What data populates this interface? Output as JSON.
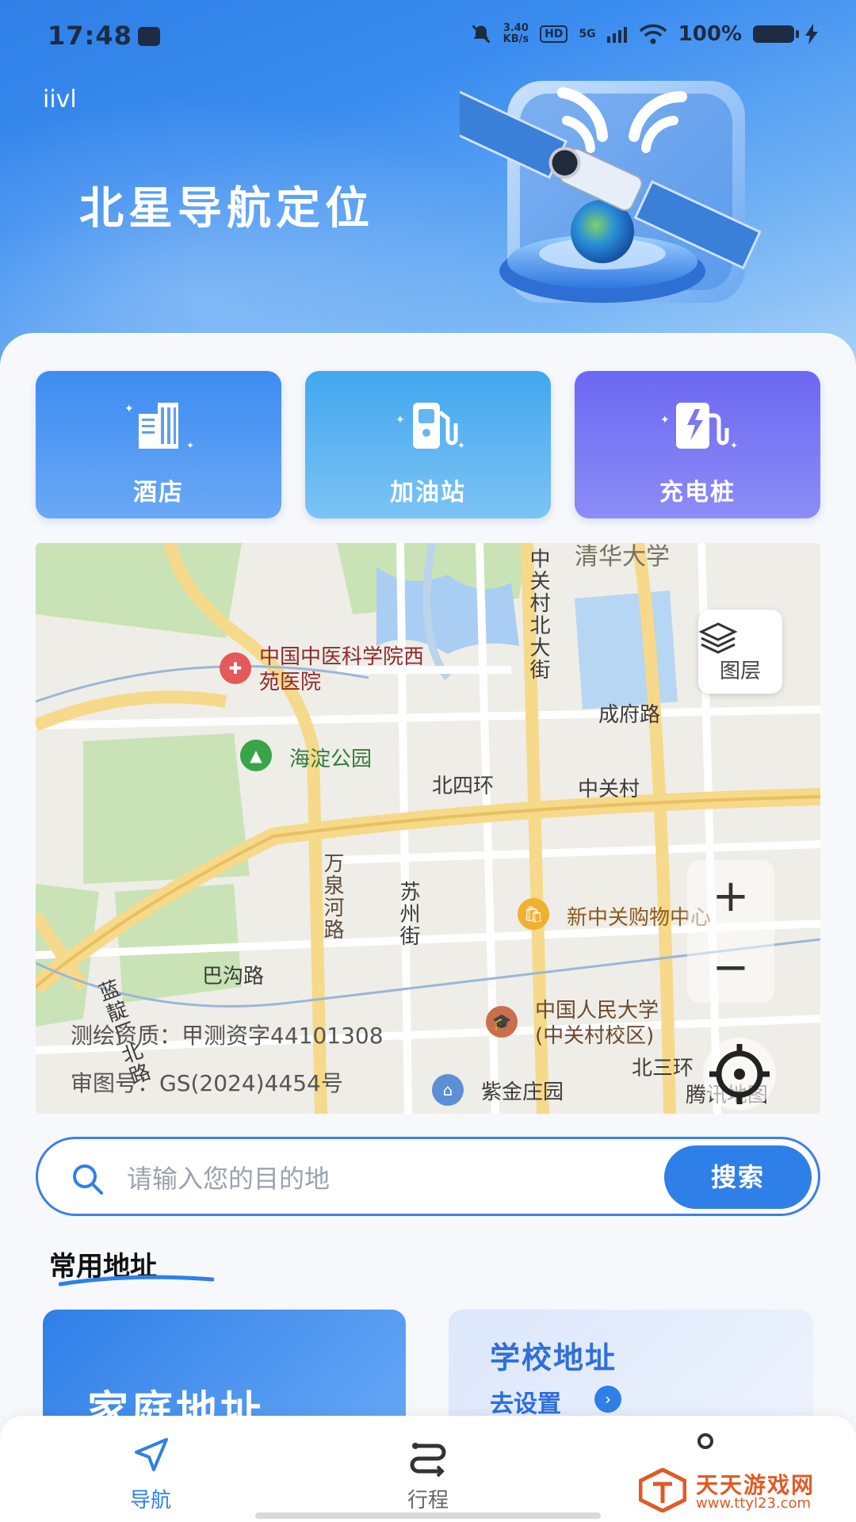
{
  "status_bar": {
    "time": "17:48",
    "net_speed_value": "3.40",
    "net_speed_unit": "KB/s",
    "hd": "HD",
    "signal": "5G",
    "battery": "100%"
  },
  "header": {
    "tag": "iivl",
    "title": "北星导航定位"
  },
  "quick_actions": [
    {
      "label": "酒店",
      "icon": "hotel-building-icon"
    },
    {
      "label": "加油站",
      "icon": "gas-pump-icon"
    },
    {
      "label": "充电桩",
      "icon": "ev-charger-icon"
    }
  ],
  "map": {
    "layer_label": "图层",
    "labels": {
      "tsinghua": "清华大学",
      "zgc_north": "中关村北大街",
      "hospital": "中国中医科学院西苑医院",
      "chengfu": "成府路",
      "haidian_park": "海淀公园",
      "north_4th_ring": "北四环",
      "zhongguancun": "中关村",
      "wanquanhe": "万泉河路",
      "suzhou": "苏州街",
      "mall": "新中关购物中心",
      "bagou": "巴沟路",
      "landianchang": "蓝靛厂北路",
      "renmin_univ": "中国人民大学\n(中关村校区)",
      "zijin": "紫金庄园",
      "north_3rd": "北三环",
      "provider": "腾讯地图"
    },
    "qualification": "测绘资质：甲测资字44101308",
    "review_no": "审图号：GS(2024)4454号",
    "zoom_in": "+",
    "zoom_out": "−"
  },
  "search": {
    "placeholder": "请输入您的目的地",
    "button": "搜索"
  },
  "common_address": {
    "title": "常用地址",
    "home": "家庭地址",
    "school": "学校地址",
    "school_action": "去设置"
  },
  "bottom_nav": [
    {
      "label": "导航",
      "active": true
    },
    {
      "label": "行程",
      "active": false
    },
    {
      "label": "",
      "active": false
    }
  ],
  "watermark": {
    "name": "天天游戏网",
    "url": "www.ttyl23.com"
  },
  "colors": {
    "primary": "#2f7fe8",
    "hotel": "#3d8cf1",
    "gas": "#42a7ef",
    "ev": "#6d68f3"
  }
}
